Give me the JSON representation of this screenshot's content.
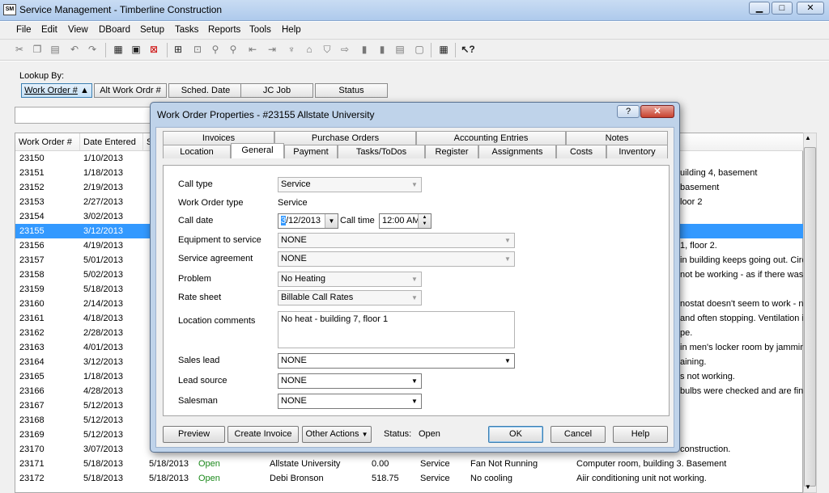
{
  "window": {
    "title": "Service Management - Timberline Construction",
    "icon_text": "SM",
    "min": "▁",
    "max": "□",
    "close": "✕"
  },
  "menu": [
    "File",
    "Edit",
    "View",
    "DBoard",
    "Setup",
    "Tasks",
    "Reports",
    "Tools",
    "Help"
  ],
  "lookup": {
    "label": "Lookup By:",
    "buttons": [
      "Work Order #",
      "Alt Work Ordr #",
      "Sched. Date",
      "JC Job",
      "Status"
    ]
  },
  "grid": {
    "headers": [
      "Work Order #",
      "Date Entered",
      "S"
    ],
    "rows": [
      {
        "wo": "23150",
        "date": "1/10/2013",
        "tail": ""
      },
      {
        "wo": "23151",
        "date": "1/18/2013",
        "tail": "uilding 4, basement"
      },
      {
        "wo": "23152",
        "date": "2/19/2013",
        "tail": "basement"
      },
      {
        "wo": "23153",
        "date": "2/27/2013",
        "tail": "loor 2"
      },
      {
        "wo": "23154",
        "date": "3/02/2013",
        "tail": ""
      },
      {
        "wo": "23155",
        "date": "3/12/2013",
        "tail": ""
      },
      {
        "wo": "23156",
        "date": "4/19/2013",
        "tail": "1, floor 2."
      },
      {
        "wo": "23157",
        "date": "5/01/2013",
        "tail": "in building keeps going out.  Circu"
      },
      {
        "wo": "23158",
        "date": "5/02/2013",
        "tail": "not be working - as if there was n"
      },
      {
        "wo": "23159",
        "date": "5/18/2013",
        "tail": ""
      },
      {
        "wo": "23160",
        "date": "2/14/2013",
        "tail": "nostat doesn't seem to work - new"
      },
      {
        "wo": "23161",
        "date": "4/18/2013",
        "tail": "and often stopping.  Ventilation is"
      },
      {
        "wo": "23162",
        "date": "2/28/2013",
        "tail": "pe."
      },
      {
        "wo": "23163",
        "date": "4/01/2013",
        "tail": "in men's locker room by jamming t"
      },
      {
        "wo": "23164",
        "date": "3/12/2013",
        "tail": "aining."
      },
      {
        "wo": "23165",
        "date": "1/18/2013",
        "tail": "s not working."
      },
      {
        "wo": "23166",
        "date": "4/28/2013",
        "tail": "bulbs were checked and are fine."
      },
      {
        "wo": "23167",
        "date": "5/12/2013",
        "tail": ""
      },
      {
        "wo": "23168",
        "date": "5/12/2013",
        "tail": ""
      },
      {
        "wo": "23169",
        "date": "5/12/2013",
        "tail": ""
      },
      {
        "wo": "23170",
        "date": "3/07/2013",
        "tail": "construction."
      },
      {
        "wo": "23171",
        "date": "5/18/2013",
        "sched": "5/18/2013",
        "status": "Open",
        "customer": "Allstate University",
        "amount": "0.00",
        "type": "Service",
        "problem": "Fan Not Running",
        "desc": "Computer room, building 3. Basement"
      },
      {
        "wo": "23172",
        "date": "5/18/2013",
        "sched": "5/18/2013",
        "status": "Open",
        "customer": "Debi Bronson",
        "amount": "518.75",
        "type": "Service",
        "problem": "No cooling",
        "desc": "Aiir conditioning unit not working."
      }
    ]
  },
  "dialog": {
    "title": "Work Order Properties - #23155 Allstate University",
    "help_glyph": "?",
    "close_glyph": "✕",
    "tabs_top": [
      "Invoices",
      "Purchase Orders",
      "Accounting Entries",
      "Notes"
    ],
    "tabs_bottom": [
      "Location",
      "General",
      "Payment",
      "Tasks/ToDos",
      "Register",
      "Assignments",
      "Costs",
      "Inventory"
    ],
    "form": {
      "call_type_label": "Call type",
      "call_type": "Service",
      "wo_type_label": "Work Order type",
      "wo_type": "Service",
      "call_date_label": "Call date",
      "call_date_month": "3",
      "call_date_rest": "/12/2013",
      "call_time_label": "Call time",
      "call_time": "12:00 AM",
      "equipment_label": "Equipment to service",
      "equipment": "NONE",
      "agreement_label": "Service agreement",
      "agreement": "NONE",
      "problem_label": "Problem",
      "problem": "No Heating",
      "rate_label": "Rate sheet",
      "rate": "Billable Call Rates",
      "loc_comments_label": "Location comments",
      "loc_comments": "No heat - building 7, floor 1",
      "sales_lead_label": "Sales lead",
      "sales_lead": "NONE",
      "lead_source_label": "Lead source",
      "lead_source": "NONE",
      "salesman_label": "Salesman",
      "salesman": "NONE"
    },
    "footer": {
      "preview": "Preview",
      "create_invoice": "Create Invoice",
      "other_actions": "Other Actions",
      "status_label": "Status:",
      "status": "Open",
      "ok": "OK",
      "cancel": "Cancel",
      "help": "Help"
    }
  }
}
